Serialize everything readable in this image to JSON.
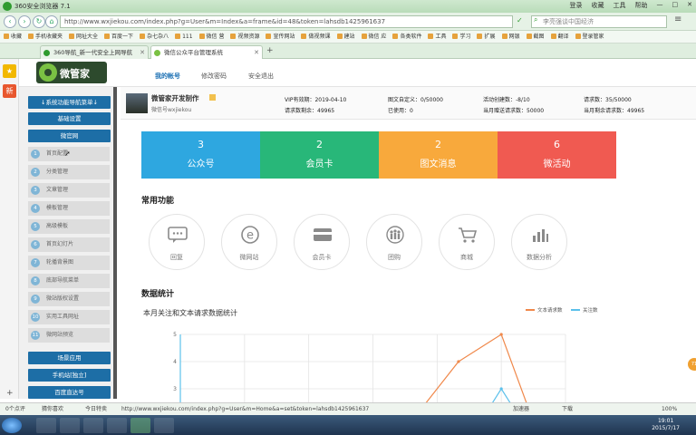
{
  "browser": {
    "title": "360安全浏览器 7.1",
    "window_menu": [
      "登录",
      "收藏",
      "工具",
      "帮助"
    ],
    "url": "http://www.wxjiekou.com/index.php?g=User&m=Index&a=frame&id=48&token=lahsdb1425961637",
    "search_placeholder": "李亮强谈中国经济",
    "bookmarks": [
      "收藏",
      "手机收藏夹",
      "网址大全",
      "百度一下",
      "杂七杂八",
      "111",
      "微信 营",
      "视频资源",
      "宣传网站",
      "做视频课",
      "建站",
      "微信 应",
      "各类软件",
      "工具",
      "学习",
      "扩展",
      "网银",
      "截图",
      "翻译",
      "登录管家"
    ],
    "tabs": [
      {
        "label": "360导航_新一代安全上网导航",
        "active": false
      },
      {
        "label": "微信公众平台管理系统",
        "active": true
      }
    ]
  },
  "app": {
    "brand": "微管家",
    "topnav": [
      "我的帐号",
      "修改密码",
      "安全退出"
    ]
  },
  "sidebar": {
    "top_buttons": [
      "↓系统功能导航菜单↓",
      "基础设置",
      "微官网"
    ],
    "items": [
      {
        "num": "1",
        "label": "首页配置"
      },
      {
        "num": "2",
        "label": "分类管理"
      },
      {
        "num": "3",
        "label": "文章管理"
      },
      {
        "num": "4",
        "label": "模板管理"
      },
      {
        "num": "5",
        "label": "高级模板"
      },
      {
        "num": "6",
        "label": "首页幻灯片"
      },
      {
        "num": "7",
        "label": "轮播背景图"
      },
      {
        "num": "8",
        "label": "底部导航菜单"
      },
      {
        "num": "9",
        "label": "微站版权设置"
      },
      {
        "num": "10",
        "label": "实用工具网址"
      },
      {
        "num": "11",
        "label": "微网站预览"
      }
    ],
    "bottom_buttons": [
      "场景应用",
      "手机站[独立]",
      "百度直达号"
    ]
  },
  "account": {
    "name": "微管家开发制作",
    "wechat": "微信号wxjiekou",
    "vip_label": "VIP有效期：2019-04-10",
    "remaining_label": "请求数剩余：49965",
    "custom_label": "图文自定义：0/50000",
    "used_label": "已使用：0",
    "activity_label": "活动创建数：-8/10",
    "monthly_label": "当月赠送请求数：50000",
    "requests_label": "请求数：35/50000",
    "monthly_remaining_label": "当月剩余请求数：49965"
  },
  "stats": [
    {
      "value": "3",
      "label": "公众号",
      "color": "#2ea7e0"
    },
    {
      "value": "2",
      "label": "会员卡",
      "color": "#28b779"
    },
    {
      "value": "2",
      "label": "图文消息",
      "color": "#f8a93c"
    },
    {
      "value": "6",
      "label": "微活动",
      "color": "#f05a51"
    }
  ],
  "functions": {
    "title": "常用功能",
    "items": [
      {
        "label": "回复",
        "icon": "chat-icon"
      },
      {
        "label": "微网站",
        "icon": "ie-icon"
      },
      {
        "label": "会员卡",
        "icon": "card-icon"
      },
      {
        "label": "团购",
        "icon": "group-icon"
      },
      {
        "label": "商城",
        "icon": "cart-icon"
      },
      {
        "label": "数据分析",
        "icon": "bar-chart-icon"
      }
    ]
  },
  "stats_section": {
    "title": "数据统计",
    "subtitle": "本月关注和文本请求数据统计"
  },
  "chart_data": {
    "type": "line",
    "title": "本月关注和文本请求数据统计",
    "legend": [
      "文本请求数",
      "关注数"
    ],
    "legend_position": "top-right",
    "y_ticks": [
      "5",
      "4",
      "3"
    ],
    "ylim": [
      2,
      5
    ],
    "series": [
      {
        "name": "文本请求数",
        "color": "#f0884a",
        "x": [
          5.5,
          6.5,
          7.5,
          8.2
        ],
        "values": [
          2,
          4,
          5,
          2
        ]
      },
      {
        "name": "关注数",
        "color": "#5bc0eb",
        "x": [
          7.1,
          7.5,
          7.9
        ],
        "values": [
          2,
          3,
          2
        ]
      }
    ]
  },
  "statusbar": {
    "left": "0个点评",
    "fav": "猜你喜欢",
    "today": "今日特卖",
    "link": "http://www.wxjiekou.com/index.php?g=User&m=Home&a=set&token=lahsdb1425961637",
    "speed": "加速器",
    "download": "下载",
    "zoom": "100%"
  },
  "clock": {
    "time": "19:01",
    "date": "2015/7/17"
  }
}
